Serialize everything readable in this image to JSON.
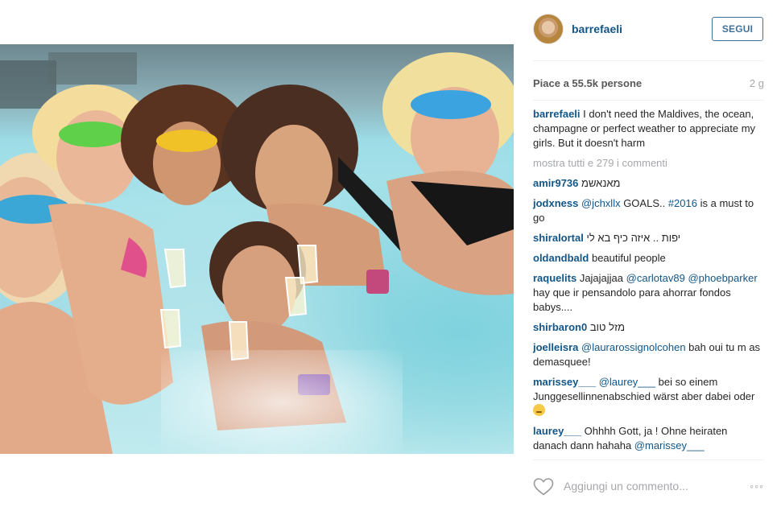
{
  "post": {
    "username": "barrefaeli",
    "follow_label": "SEGUI",
    "likes_text": "Piace a 55.5k persone",
    "time_ago": "2 g",
    "caption_user": "barrefaeli",
    "caption_text": "I don't need the Maldives, the ocean, champagne or perfect weather to appreciate my girls. But it doesn't harm",
    "show_all_comments": "mostra tutti e 279 i commenti",
    "add_comment_placeholder": "Aggiungi un commento...",
    "more_options": "◦◦◦"
  },
  "comments": [
    {
      "user": "amir9736",
      "parts": [
        {
          "t": "מאנאשמ",
          "m": false
        }
      ]
    },
    {
      "user": "jodxness",
      "parts": [
        {
          "t": "@jchxllx",
          "m": true
        },
        {
          "t": " GOALS.. ",
          "m": false
        },
        {
          "t": "#2016",
          "m": true
        },
        {
          "t": " is a must to go",
          "m": false
        }
      ]
    },
    {
      "user": "shiralortal",
      "parts": [
        {
          "t": "יפות .. איזה כיף בא לי",
          "m": false
        }
      ]
    },
    {
      "user": "oldandbald",
      "parts": [
        {
          "t": "beautiful people",
          "m": false
        }
      ]
    },
    {
      "user": "raquelits",
      "parts": [
        {
          "t": "Jajajajjaa ",
          "m": false
        },
        {
          "t": "@carlotav89",
          "m": true
        },
        {
          "t": " ",
          "m": false
        },
        {
          "t": "@phoebparker",
          "m": true
        },
        {
          "t": " hay que ir pensandolo para ahorrar fondos babys....",
          "m": false
        }
      ]
    },
    {
      "user": "shirbaron0",
      "parts": [
        {
          "t": "מזל טוב",
          "m": false
        }
      ]
    },
    {
      "user": "joelleisra",
      "parts": [
        {
          "t": "@laurarossignolcohen",
          "m": true
        },
        {
          "t": " bah oui tu m as demasquee!",
          "m": false
        }
      ]
    },
    {
      "user": "marissey___",
      "parts": [
        {
          "t": "@laurey___",
          "m": true
        },
        {
          "t": " bei so einem Junggesellinnenabschied wärst aber dabei oder ",
          "m": false
        }
      ],
      "emoji": true
    },
    {
      "user": "laurey___",
      "parts": [
        {
          "t": "Ohhhh Gott, ja ! Ohne heiraten danach dann hahaha ",
          "m": false
        },
        {
          "t": "@marissey___",
          "m": true
        }
      ]
    }
  ]
}
